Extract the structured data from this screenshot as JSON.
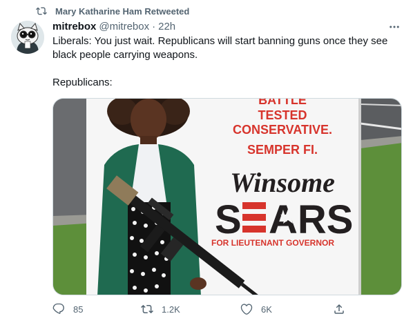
{
  "retweet": {
    "label": "Mary Katharine Ham Retweeted",
    "icon": "retweet-icon"
  },
  "author": {
    "name": "mitrebox",
    "handle": "@mitrebox",
    "separator": "·",
    "time": "22h",
    "avatar_icon": "cartoon-cat-avatar"
  },
  "more_icon": "more-dots-icon",
  "tweet": {
    "paragraph1": "Liberals: You just wait. Republicans will start banning guns once they see black people carrying weapons.",
    "paragraph2": "Republicans:"
  },
  "media": {
    "sign_line1": "BATTLE",
    "sign_line2": "TESTED",
    "sign_line3": "CONSERVATIVE.",
    "sign_line4": "SEMPER FI.",
    "sign_first_name": "Winsome",
    "sign_last_name_s": "S",
    "sign_last_name_rest": "ARS",
    "sign_subtitle": "FOR LIEUTENANT GOVERNOR",
    "colors": {
      "sign_red": "#d7342c",
      "sign_black": "#231f20",
      "sign_white": "#f6f6f6",
      "grass": "#5d8f3a",
      "asphalt": "#5b5d60",
      "jacket": "#1f6a50"
    }
  },
  "actions": {
    "reply_count": "85",
    "retweet_count": "1.2K",
    "like_count": "6K",
    "reply_icon": "reply-icon",
    "retweet_icon": "retweet-icon",
    "like_icon": "heart-icon",
    "share_icon": "share-icon"
  },
  "colors": {
    "secondary_text": "#536471",
    "primary_text": "#0f1419",
    "border": "#cfd9de"
  }
}
